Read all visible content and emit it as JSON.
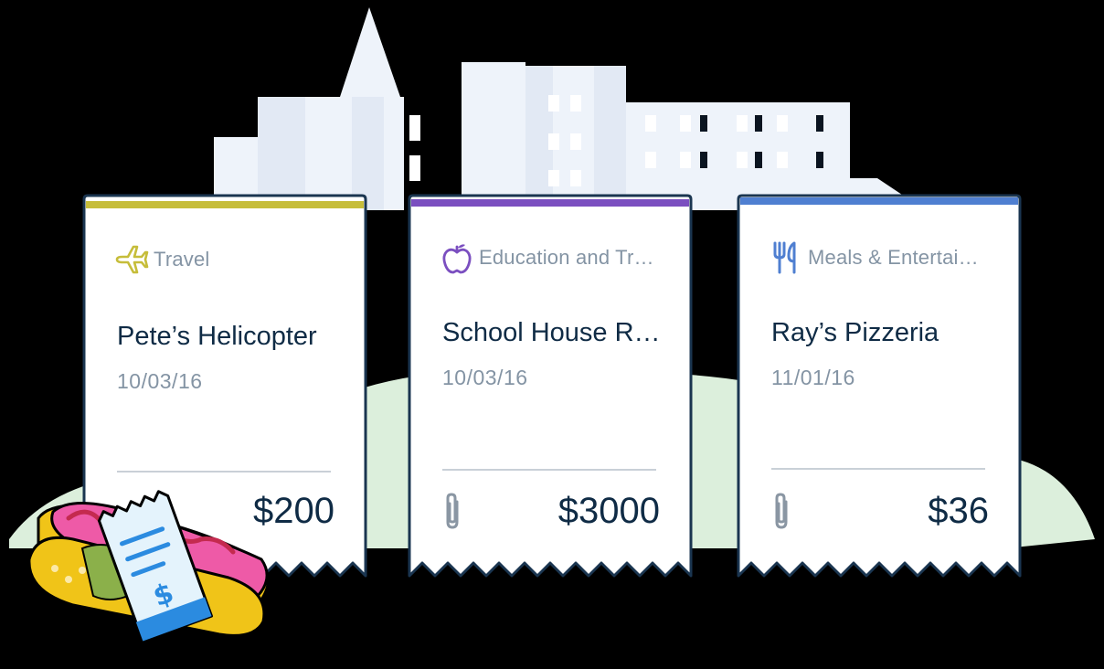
{
  "expenses": [
    {
      "category": "Travel",
      "category_icon": "airplane-icon",
      "accent_color": "#c6bd3a",
      "merchant": "Pete’s Helicopter",
      "date": "10/03/16",
      "amount": "$200",
      "has_attachment": false
    },
    {
      "category": "Education and Tr…",
      "category_icon": "apple-icon",
      "accent_color": "#7b4fc0",
      "merchant": "School House R…",
      "date": "10/03/16",
      "amount": "$3000",
      "has_attachment": true,
      "attachment_icon": "paperclip-icon"
    },
    {
      "category": "Meals & Entertai…",
      "category_icon": "fork-knife-icon",
      "accent_color": "#4f7fd1",
      "merchant": "Ray’s Pizzeria",
      "date": "11/01/16",
      "amount": "$36",
      "has_attachment": true,
      "attachment_icon": "paperclip-icon"
    }
  ],
  "illustration": {
    "background": "city-skyline",
    "foreground": "hotdog-with-receipt",
    "receipt_symbol": "$"
  }
}
